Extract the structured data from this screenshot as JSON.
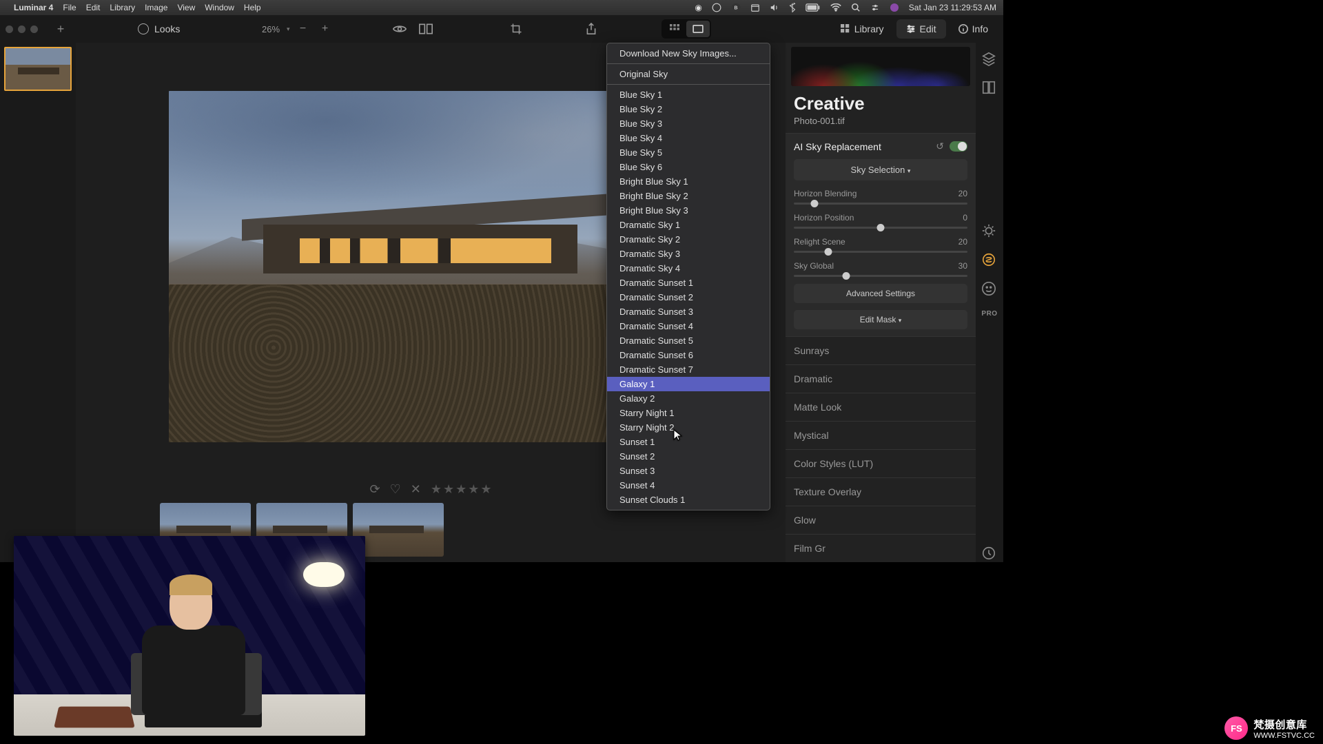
{
  "menubar": {
    "app": "Luminar 4",
    "items": [
      "File",
      "Edit",
      "Library",
      "Image",
      "View",
      "Window",
      "Help"
    ],
    "clock": "Sat Jan 23  11:29:53 AM"
  },
  "toolbar": {
    "looks": "Looks",
    "zoom": "26%",
    "tabs": {
      "library": "Library",
      "edit": "Edit",
      "info": "Info"
    }
  },
  "panel": {
    "title": "Creative",
    "filename": "Photo-001.tif",
    "ai_sky": {
      "label": "AI Sky Replacement",
      "dropdown": "Sky Selection",
      "sliders": [
        {
          "name": "Horizon Blending",
          "value": "20",
          "pos": 12
        },
        {
          "name": "Horizon Position",
          "value": "0",
          "pos": 50
        },
        {
          "name": "Relight Scene",
          "value": "20",
          "pos": 20
        },
        {
          "name": "Sky Global",
          "value": "30",
          "pos": 30
        }
      ],
      "advanced": "Advanced Settings",
      "editmask": "Edit Mask"
    },
    "collapsed": [
      "Sunrays",
      "Dramatic",
      "Matte Look",
      "Mystical",
      "Color Styles (LUT)",
      "Texture Overlay",
      "Glow",
      "Film Gr"
    ]
  },
  "context_menu": {
    "download": "Download New Sky Images...",
    "items": [
      "Original Sky",
      "Blue Sky 1",
      "Blue Sky 2",
      "Blue Sky 3",
      "Blue Sky 4",
      "Blue Sky 5",
      "Blue Sky 6",
      "Bright Blue Sky 1",
      "Bright Blue Sky 2",
      "Bright Blue Sky 3",
      "Dramatic Sky 1",
      "Dramatic Sky 2",
      "Dramatic Sky 3",
      "Dramatic Sky 4",
      "Dramatic Sunset 1",
      "Dramatic Sunset 2",
      "Dramatic Sunset 3",
      "Dramatic Sunset 4",
      "Dramatic Sunset 5",
      "Dramatic Sunset 6",
      "Dramatic Sunset 7",
      "Galaxy 1",
      "Galaxy 2",
      "Starry Night 1",
      "Starry Night 2",
      "Sunset 1",
      "Sunset 2",
      "Sunset 3",
      "Sunset 4",
      "Sunset Clouds 1"
    ],
    "selected": "Galaxy 1"
  },
  "toolstrip": {
    "pro": "PRO"
  },
  "watermark": {
    "badge": "FS",
    "text": "梵摄创意库",
    "url": "WWW.FSTVC.CC"
  }
}
